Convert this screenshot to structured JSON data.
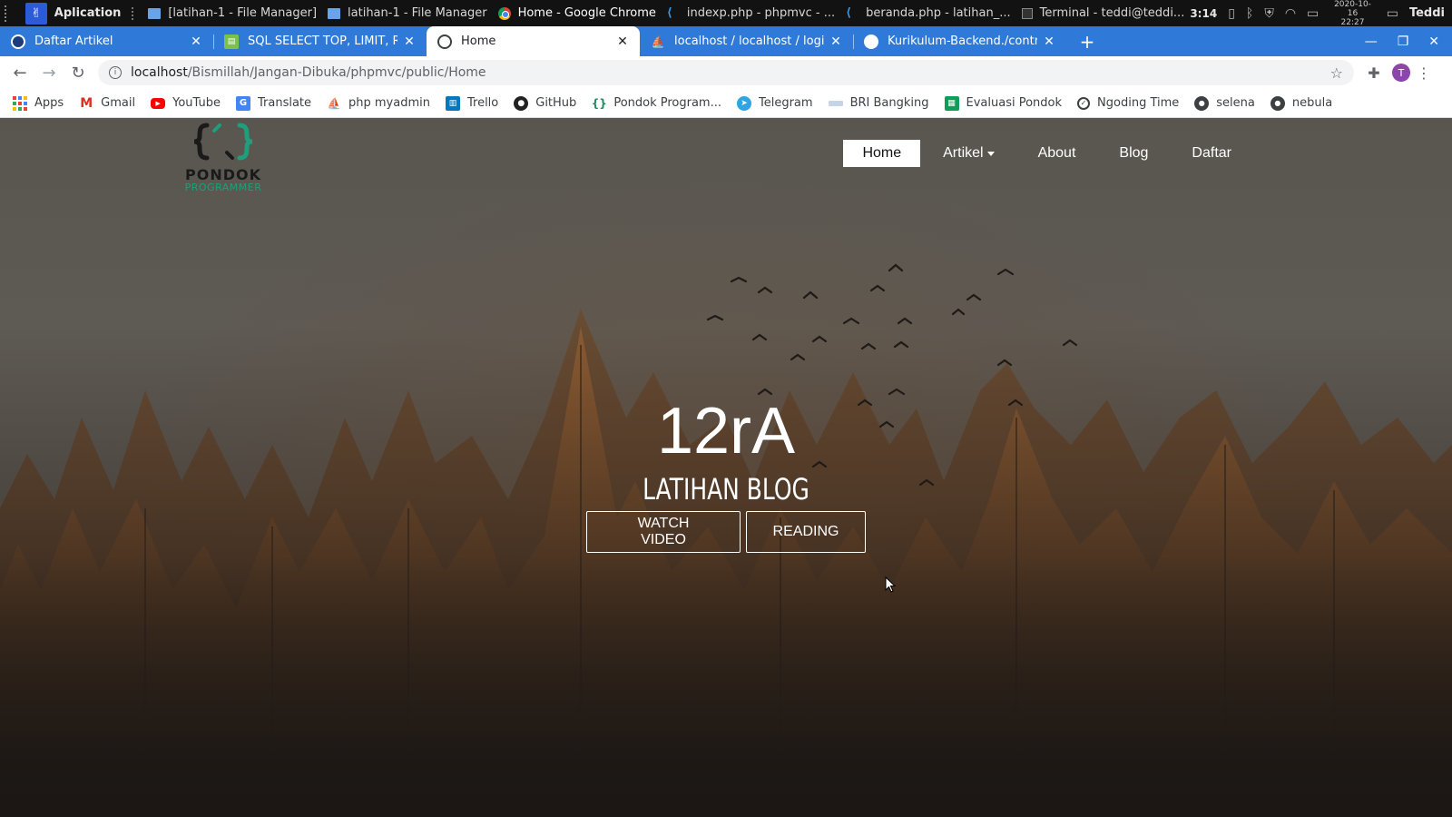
{
  "taskbar": {
    "app_menu": "Aplication",
    "windows": [
      {
        "label": "[latihan-1 - File Manager]",
        "icon": "folder-icon"
      },
      {
        "label": "latihan-1 - File Manager",
        "icon": "folder-icon"
      },
      {
        "label": "Home - Google Chrome",
        "icon": "chrome-icon",
        "active": true
      },
      {
        "label": "indexp.php - phpmvc - ...",
        "icon": "vscode-icon"
      },
      {
        "label": "beranda.php - latihan_...",
        "icon": "vscode-icon"
      },
      {
        "label": "Terminal - teddi@teddi...",
        "icon": "terminal-icon"
      }
    ],
    "time": "3:14",
    "date": "2020-10-16",
    "clock": "22:27",
    "user": "Teddi"
  },
  "tabs": [
    {
      "title": "Daftar Artikel",
      "icon": "globe-icon"
    },
    {
      "title": "SQL SELECT TOP, LIMIT, ROWNUM",
      "icon": "sql-icon"
    },
    {
      "title": "Home",
      "icon": "globe-icon",
      "active": true
    },
    {
      "title": "localhost / localhost / login / ...",
      "icon": "phpmyadmin-icon"
    },
    {
      "title": "Kurikulum-Backend./controllers",
      "icon": "github-icon"
    }
  ],
  "address": {
    "host": "localhost",
    "path": "/Bismillah/Jangan-Dibuka/phpmvc/public/Home",
    "profile_initial": "T"
  },
  "bookmarks": [
    {
      "label": "Apps",
      "icon": "apps-icon"
    },
    {
      "label": "Gmail",
      "icon": "gmail-icon"
    },
    {
      "label": "YouTube",
      "icon": "youtube-icon"
    },
    {
      "label": "Translate",
      "icon": "translate-icon"
    },
    {
      "label": "php myadmin",
      "icon": "phpmyadmin-icon"
    },
    {
      "label": "Trello",
      "icon": "trello-icon"
    },
    {
      "label": "GitHub",
      "icon": "github-icon"
    },
    {
      "label": "Pondok Program...",
      "icon": "pondok-icon"
    },
    {
      "label": "Telegram",
      "icon": "telegram-icon"
    },
    {
      "label": "BRI Bangking",
      "icon": "bri-icon"
    },
    {
      "label": "Evaluasi Pondok",
      "icon": "sheets-icon"
    },
    {
      "label": "Ngoding Time",
      "icon": "clock-icon"
    },
    {
      "label": "selena",
      "icon": "globe-icon"
    },
    {
      "label": "nebula",
      "icon": "globe-icon"
    }
  ],
  "site": {
    "logo_title": "PONDOK",
    "logo_sub": "PROGRAMMER",
    "nav": {
      "home": "Home",
      "artikel": "Artikel",
      "about": "About",
      "blog": "Blog",
      "daftar": "Daftar"
    },
    "hero": {
      "title": "12rA",
      "subtitle": "LATIHAN BLOG",
      "watch_btn": "WATCH VIDEO",
      "read_btn": "READING"
    },
    "colors": {
      "logo_accent": "#1e9e7a",
      "tab_strip": "#2f7ad8"
    }
  }
}
